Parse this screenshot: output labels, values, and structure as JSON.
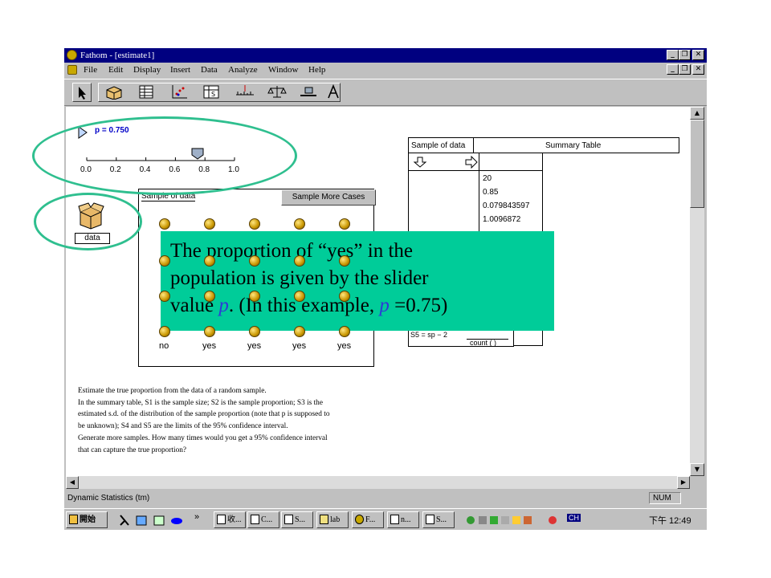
{
  "window": {
    "title": "Fathom - [estimate1]",
    "min_label": "_",
    "restore_label": "❐",
    "close_label": "✕"
  },
  "menu": {
    "items": [
      "File",
      "Edit",
      "Display",
      "Insert",
      "Data",
      "Analyze",
      "Window",
      "Help"
    ]
  },
  "toolbar": {
    "tools": [
      "selection-arrow",
      "collection-box",
      "case-table",
      "graph",
      "summary-table",
      "estimate-ruler",
      "balance-test",
      "slider",
      "text-a"
    ]
  },
  "slider": {
    "label": "p",
    "value_text": "= 0.750",
    "ticks": [
      "0.0",
      "0.2",
      "0.4",
      "0.6",
      "0.8",
      "1.0"
    ],
    "value": 0.75,
    "min": 0.0,
    "max": 1.0
  },
  "collection": {
    "label": "data"
  },
  "sample": {
    "title": "Sample of data",
    "button_label": "Sample More Cases",
    "bottom_labels": [
      "no",
      "yes",
      "yes",
      "yes",
      "yes"
    ]
  },
  "summary": {
    "header_left": "Sample of data",
    "header_right": "Summary Table",
    "values": [
      "20",
      "0.85",
      "0.079843597",
      "1.0096872"
    ],
    "formula_left": "S5 = sp − 2",
    "formula_denominator": "count ( )"
  },
  "callout": {
    "line1": "The proportion of “yes” in the",
    "line2": "population is given by the slider",
    "line3_prefix": "value ",
    "p1": "p",
    "line3_middle": ". (In this example, ",
    "p2": "p",
    "line3_suffix": " =0.75)"
  },
  "instructions": {
    "lines": [
      "Estimate the true proportion from the data of a random sample.",
      "In the summary table, S1 is the sample size; S2 is the sample proportion; S3 is the",
      "estimated s.d. of the distribution of the sample proportion (note that p is supposed to",
      "be unknown); S4  and S5 are the limits of the 95% confidence interval.",
      "Generate more samples. How many times would you get a 95% confidence interval",
      "that can capture the true proportion?"
    ]
  },
  "status": {
    "text": "Dynamic Statistics (tm)",
    "num": "NUM"
  },
  "taskbar": {
    "start": "開始",
    "tasks": [
      "收...",
      "C...",
      "S...",
      "lab",
      "F...",
      "n...",
      "S..."
    ],
    "chevron": "»",
    "tray_ch": "CH",
    "clock": "下午 12:49"
  },
  "colors": {
    "title_bar": "#000080",
    "callout_bg": "#00cc99",
    "highlight_oval": "#2fbf8f",
    "slider_value": "#0000c8",
    "p_symbol": "#2e3bd6"
  }
}
